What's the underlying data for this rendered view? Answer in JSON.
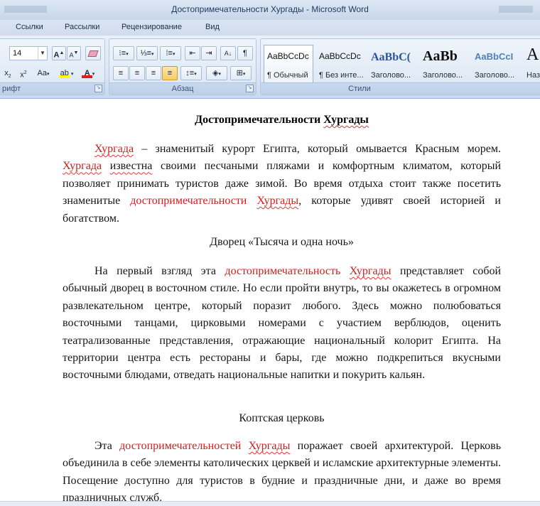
{
  "window": {
    "title": "Достопримечательности Хургады - Microsoft Word"
  },
  "tabs": [
    "Ссылки",
    "Рассылки",
    "Рецензирование",
    "Вид"
  ],
  "ribbon": {
    "font_group_label": "рифт",
    "font_size": "14",
    "paragraph_group_label": "Абзац",
    "styles_group_label": "Стили",
    "styles": [
      {
        "preview": "AaBbCcDc",
        "name": "¶ Обычный"
      },
      {
        "preview": "AaBbCcDc",
        "name": "¶ Без инте..."
      },
      {
        "preview": "AaBbC(",
        "name": "Заголово..."
      },
      {
        "preview": "AaBb",
        "name": "Заголово..."
      },
      {
        "preview": "AaBbCcI",
        "name": "Заголово..."
      },
      {
        "preview": "A",
        "name": "Наз"
      }
    ],
    "colors": {
      "highlight": "#ffff00",
      "font_color": "#e31b1b",
      "accent": "#1f4e8c"
    }
  },
  "document": {
    "title": {
      "a": "Достопримечательности",
      "b": "Хургады"
    },
    "p1": {
      "s1": "Хургада",
      "s2": " – знаменитый курорт Египта, который омывается Красным морем. ",
      "s3": "Хургада",
      "s4": " ",
      "s5": "известна",
      "s6": " своими песчаными  пляжами и комфортным климатом, который позволяет принимать туристов даже зимой. Во время отдыха стоит также посетить знаменитые ",
      "s7": "достопримечательности",
      "s8": " ",
      "s9": "Хургады",
      "s10": ", которые удивят своей историей и богатством."
    },
    "h2": "Дворец «Тысяча и одна ночь»",
    "p2": {
      "s1": "На первый взгляд эта ",
      "s2": "достопримечательность",
      "s3": " ",
      "s4": "Хургады",
      "s5": " представляет собой обычный дворец в восточном стиле. Но если пройти внутрь, то вы окажетесь в огромном развлекательном центре, который поразит любого. Здесь можно полюбоваться восточными танцами, цирковыми номерами с участием верблюдов, оценить театрализованные представления, отражающие национальный колорит Египта. На территории центра есть рестораны и бары, где можно подкрепиться вкусными восточными блюдами, отведать национальные напитки и покурить кальян."
    },
    "h3": "Коптская церковь",
    "p3": {
      "s1": "Эта ",
      "s2": "достопримечательностей",
      "s3": " ",
      "s4": "Хургады",
      "s5": " поражает своей архитектурой. Церковь объединила в себе элементы католических церквей и исламские архитектурные элементы. Посещение доступно для туристов в будние и праздничные дни, и даже во время праздничных служб."
    }
  }
}
